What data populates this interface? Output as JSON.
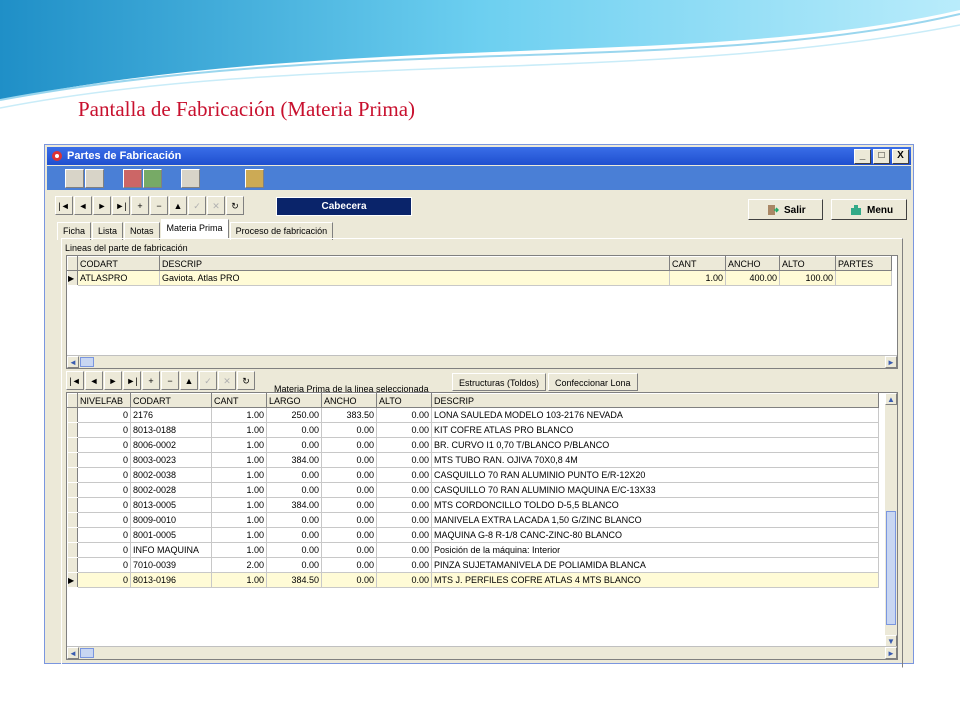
{
  "slide_title": "Pantalla de Fabricación (Materia Prima)",
  "window": {
    "title": "Partes de Fabricación",
    "controls": [
      "_",
      "□",
      "X"
    ]
  },
  "nav_icons": [
    "|◄",
    "◄",
    "►",
    "►|",
    "+",
    "−",
    "▲",
    "✓",
    "✕",
    "↻"
  ],
  "cabecera_label": "Cabecera",
  "buttons": {
    "salir": "Salir",
    "menu": "Menu"
  },
  "tabs": [
    "Ficha",
    "Lista",
    "Notas",
    "Materia Prima",
    "Proceso de fabricación"
  ],
  "active_tab": "Materia Prima",
  "lineas": {
    "label": "Lineas del parte de fabricación",
    "columns": [
      "CODART",
      "DESCRIP",
      "CANT",
      "ANCHO",
      "ALTO",
      "PARTES"
    ],
    "rows": [
      [
        "ATLASPRO",
        "Gaviota. Atlas PRO",
        "1.00",
        "400.00",
        "100.00",
        ""
      ]
    ]
  },
  "materia": {
    "label": "Materia Prima de la linea seleccionada",
    "subtabs": [
      "Estructuras (Toldos)",
      "Confeccionar Lona"
    ],
    "columns": [
      "NIVELFAB",
      "CODART",
      "CANT",
      "LARGO",
      "ANCHO",
      "ALTO",
      "DESCRIP"
    ],
    "rows": [
      [
        "0",
        "2176",
        "1.00",
        "250.00",
        "383.50",
        "0.00",
        "LONA SAULEDA MODELO 103-2176 NEVADA"
      ],
      [
        "0",
        "8013-0188",
        "1.00",
        "0.00",
        "0.00",
        "0.00",
        "KIT COFRE ATLAS PRO BLANCO"
      ],
      [
        "0",
        "8006-0002",
        "1.00",
        "0.00",
        "0.00",
        "0.00",
        "BR. CURVO I1 0,70 T/BLANCO P/BLANCO"
      ],
      [
        "0",
        "8003-0023",
        "1.00",
        "384.00",
        "0.00",
        "0.00",
        "MTS TUBO RAN. OJIVA 70X0,8 4M"
      ],
      [
        "0",
        "8002-0038",
        "1.00",
        "0.00",
        "0.00",
        "0.00",
        "CASQUILLO 70 RAN ALUMINIO PUNTO E/R-12X20"
      ],
      [
        "0",
        "8002-0028",
        "1.00",
        "0.00",
        "0.00",
        "0.00",
        "CASQUILLO 70 RAN ALUMINIO MAQUINA E/C-13X33"
      ],
      [
        "0",
        "8013-0005",
        "1.00",
        "384.00",
        "0.00",
        "0.00",
        "MTS CORDONCILLO TOLDO D-5,5 BLANCO"
      ],
      [
        "0",
        "8009-0010",
        "1.00",
        "0.00",
        "0.00",
        "0.00",
        "MANIVELA EXTRA LACADA 1,50 G/ZINC BLANCO"
      ],
      [
        "0",
        "8001-0005",
        "1.00",
        "0.00",
        "0.00",
        "0.00",
        "MAQUINA G-8 R-1/8 CANC-ZINC-80 BLANCO"
      ],
      [
        "0",
        "INFO MAQUINA",
        "1.00",
        "0.00",
        "0.00",
        "0.00",
        "Posición de la máquina: Interior"
      ],
      [
        "0",
        "7010-0039",
        "2.00",
        "0.00",
        "0.00",
        "0.00",
        "PINZA SUJETAMANIVELA DE POLIAMIDA BLANCA"
      ],
      [
        "0",
        "8013-0196",
        "1.00",
        "384.50",
        "0.00",
        "0.00",
        "MTS J. PERFILES COFRE ATLAS 4 MTS BLANCO"
      ]
    ]
  },
  "colors": {
    "title_red": "#c8102e",
    "titlebar_blue": "#1f4fcf",
    "selected_row": "#fffbd6",
    "window_bg": "#ece9d8"
  }
}
